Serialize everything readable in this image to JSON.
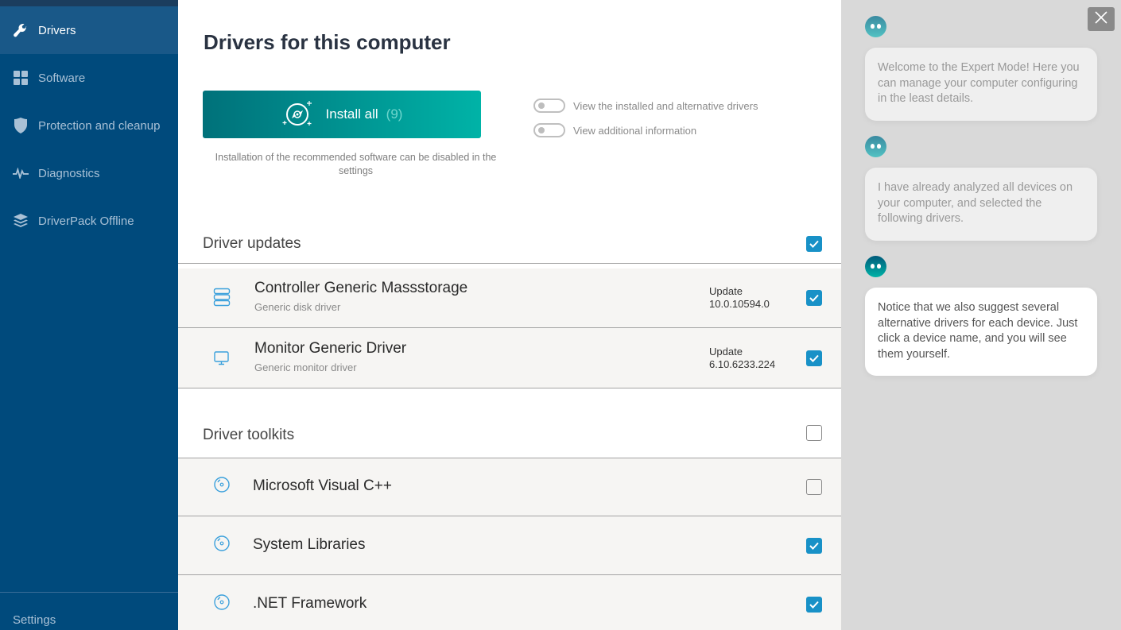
{
  "sidebar": {
    "items": [
      {
        "label": "Drivers",
        "icon": "wrench-icon",
        "active": true
      },
      {
        "label": "Software",
        "icon": "grid-icon",
        "active": false
      },
      {
        "label": "Protection and cleanup",
        "icon": "shield-icon",
        "active": false
      },
      {
        "label": "Diagnostics",
        "icon": "pulse-icon",
        "active": false
      },
      {
        "label": "DriverPack Offline",
        "icon": "layers-icon",
        "active": false
      }
    ],
    "settings_label": "Settings"
  },
  "main": {
    "title": "Drivers for this computer",
    "install_button": {
      "label": "Install all",
      "count": "(9)",
      "icon": "disc-icon"
    },
    "install_note": "Installation of the recommended software can be disabled in the settings",
    "toggles": [
      {
        "label": "View the installed and alternative drivers",
        "on": false
      },
      {
        "label": "View additional information",
        "on": false
      }
    ],
    "sections": [
      {
        "title": "Driver updates",
        "checked": true,
        "items": [
          {
            "name": "Controller Generic Massstorage",
            "subtitle": "Generic disk driver",
            "status": "Update",
            "version": "10.0.10594.0",
            "checked": true,
            "icon": "storage-icon"
          },
          {
            "name": "Monitor Generic Driver",
            "subtitle": "Generic monitor driver",
            "status": "Update",
            "version": "6.10.6233.224",
            "checked": true,
            "icon": "monitor-icon"
          }
        ]
      },
      {
        "title": "Driver toolkits",
        "checked": false,
        "items": [
          {
            "name": "Microsoft Visual C++",
            "checked": false,
            "icon": "disc-icon"
          },
          {
            "name": "System Libraries",
            "checked": true,
            "icon": "disc-icon"
          },
          {
            "name": ".NET Framework",
            "checked": true,
            "icon": "disc-icon"
          }
        ]
      }
    ]
  },
  "chat": {
    "close_icon": "close-icon",
    "messages": [
      {
        "text": "Welcome to the Expert Mode! Here you can manage your computer configuring in the least details.",
        "active": false
      },
      {
        "text": "I have already analyzed all devices on your computer, and selected the following drivers.",
        "active": false
      },
      {
        "text": "Notice that we also suggest several alternative drivers for each device. Just click a device name, and you will see them yourself.",
        "active": true
      }
    ]
  },
  "colors": {
    "sidebar_bg": "#004a7c",
    "sidebar_active": "#195888",
    "accent_gradient_start": "#00717a",
    "accent_gradient_end": "#00b3a7",
    "checkbox": "#1891c7",
    "icon_blue": "#3aa0dc"
  }
}
